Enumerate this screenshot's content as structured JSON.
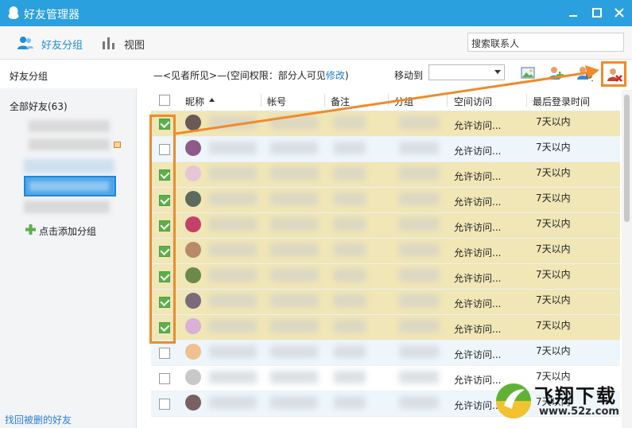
{
  "window": {
    "title": "好友管理器",
    "minimize": "minimize",
    "maximize": "maximize",
    "close": "close"
  },
  "toolbar": {
    "group_label": "好友分组",
    "view_label": "视图",
    "search_placeholder": "搜索联系人"
  },
  "sidebar": {
    "header": "好友分组",
    "all_friends": "全部好友(63)",
    "add_group": "点击添加分组",
    "recover": "找回被删的好友"
  },
  "main": {
    "permission_prefix": "—<见者所见>—(空间权限：部分人可见",
    "permission_link": "修改",
    "permission_suffix": ")",
    "move_to_label": "移动到",
    "move_to_value": ""
  },
  "table": {
    "headers": {
      "nickname": "昵称",
      "account": "帐号",
      "remark": "备注",
      "group": "分组",
      "space_access": "空间访问",
      "last_login": "最后登录时间"
    },
    "rows": [
      {
        "checked": true,
        "access": "允许访问...",
        "login": "7天以内",
        "avatar_color": "#6a5a55"
      },
      {
        "checked": false,
        "access": "允许访问...",
        "login": "7天以内",
        "avatar_color": "#8d5a8a"
      },
      {
        "checked": true,
        "access": "允许访问...",
        "login": "7天以内",
        "avatar_color": "#e6c6d6"
      },
      {
        "checked": true,
        "access": "允许访问...",
        "login": "7天以内",
        "avatar_color": "#5c6b5c"
      },
      {
        "checked": true,
        "access": "允许访问...",
        "login": "7天以内",
        "avatar_color": "#c4406a"
      },
      {
        "checked": true,
        "access": "允许访问...",
        "login": "7天以内",
        "avatar_color": "#b88a6a"
      },
      {
        "checked": true,
        "access": "允许访问...",
        "login": "7天以内",
        "avatar_color": "#6b8a4a"
      },
      {
        "checked": true,
        "access": "允许访问...",
        "login": "7天以内",
        "avatar_color": "#7a6a7a"
      },
      {
        "checked": true,
        "access": "允许访问...",
        "login": "7天以内",
        "avatar_color": "#d8b0d8"
      },
      {
        "checked": false,
        "access": "允许访问...",
        "login": "7天以内",
        "avatar_color": "#f0c090"
      },
      {
        "checked": false,
        "access": "允许访问...",
        "login": "7天以内",
        "avatar_color": "#c8c8c8"
      },
      {
        "checked": false,
        "access": "允许访问...",
        "login": "7天以内",
        "avatar_color": "#7a6060"
      }
    ]
  },
  "watermark": {
    "name": "飞翔下载",
    "url": "www.52z.com"
  },
  "colors": {
    "titlebar": "#2aa0de",
    "accent": "#1e8ed8",
    "selected_row": "#f0e6b6",
    "annotation": "#f08a2a",
    "checkbox": "#5ab14a"
  }
}
